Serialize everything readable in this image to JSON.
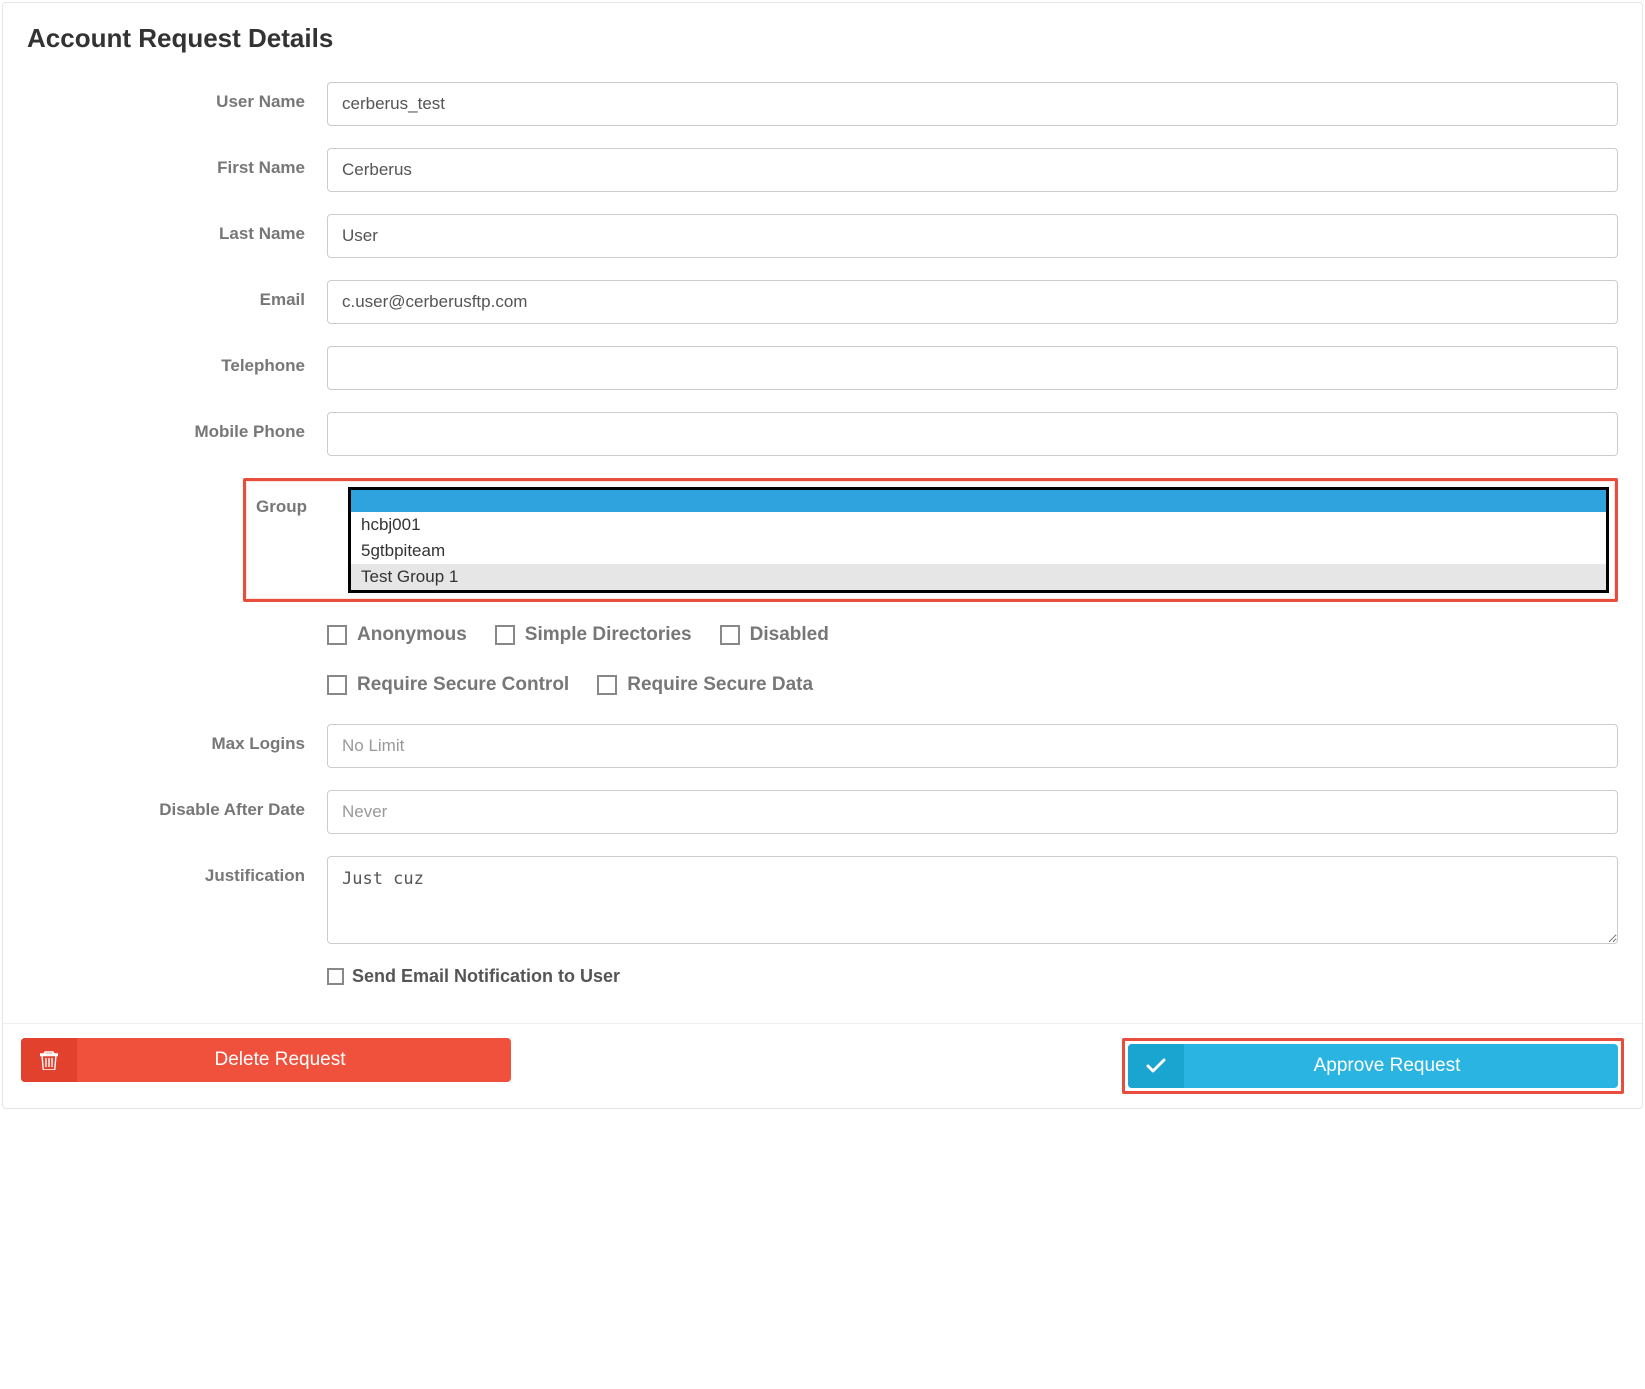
{
  "title": "Account Request Details",
  "fields": {
    "user_name": {
      "label": "User Name",
      "value": "cerberus_test"
    },
    "first_name": {
      "label": "First Name",
      "value": "Cerberus"
    },
    "last_name": {
      "label": "Last Name",
      "value": "User"
    },
    "email": {
      "label": "Email",
      "value": "c.user@cerberusftp.com"
    },
    "telephone": {
      "label": "Telephone",
      "value": ""
    },
    "mobile_phone": {
      "label": "Mobile Phone",
      "value": ""
    },
    "group": {
      "label": "Group",
      "options": [
        {
          "label": "",
          "selected": true,
          "hover": false
        },
        {
          "label": "hcbj001",
          "selected": false,
          "hover": false
        },
        {
          "label": "5gtbpiteam",
          "selected": false,
          "hover": false
        },
        {
          "label": "Test Group 1",
          "selected": false,
          "hover": true
        }
      ]
    },
    "max_logins": {
      "label": "Max Logins",
      "placeholder": "No Limit",
      "value": ""
    },
    "disable_after_date": {
      "label": "Disable After Date",
      "placeholder": "Never",
      "value": ""
    },
    "justification": {
      "label": "Justification",
      "value": "Just cuz"
    }
  },
  "checkboxes": {
    "row1": [
      {
        "label": "Anonymous",
        "checked": false
      },
      {
        "label": "Simple Directories",
        "checked": false
      },
      {
        "label": "Disabled",
        "checked": false
      }
    ],
    "row2": [
      {
        "label": "Require Secure Control",
        "checked": false
      },
      {
        "label": "Require Secure Data",
        "checked": false
      }
    ],
    "notify": {
      "label": "Send Email Notification to User",
      "checked": false
    }
  },
  "buttons": {
    "delete": "Delete Request",
    "approve": "Approve Request"
  },
  "colors": {
    "danger": "#f0513c",
    "info": "#29b4e2",
    "highlight_border": "#e74c3c"
  }
}
